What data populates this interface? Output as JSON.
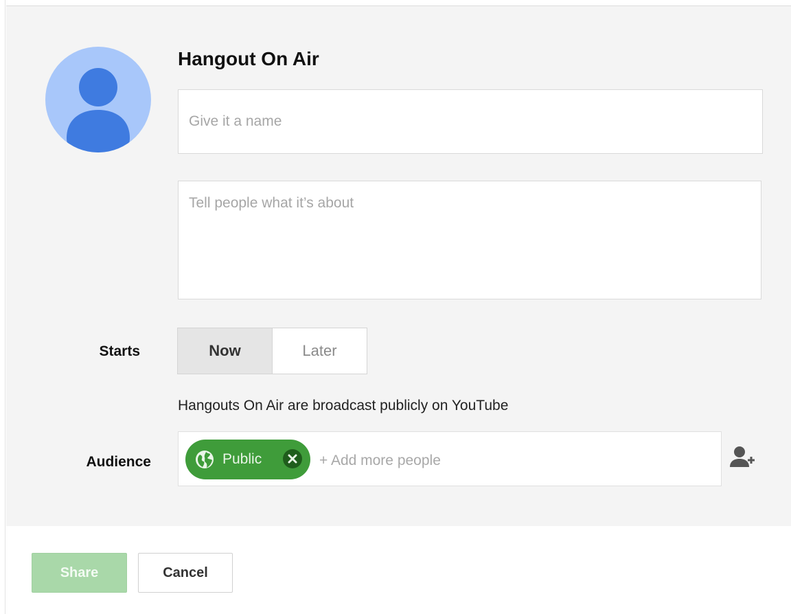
{
  "dialog": {
    "title": "Hangout On Air",
    "name_placeholder": "Give it a name",
    "about_placeholder": "Tell people what it’s about",
    "starts": {
      "label": "Starts",
      "options": [
        "Now",
        "Later"
      ],
      "selected": "Now"
    },
    "notice": "Hangouts On Air are broadcast publicly on YouTube",
    "audience": {
      "label": "Audience",
      "chip": {
        "label": "Public",
        "icon": "globe-icon",
        "color": "#3f9c3a"
      },
      "add_placeholder": "+ Add more people",
      "add_icon": "add-person-icon"
    }
  },
  "footer": {
    "share_label": "Share",
    "cancel_label": "Cancel"
  },
  "colors": {
    "accent_green": "#3f9c3a",
    "share_disabled": "#a9d8a9",
    "avatar_bg": "#a8c7fa",
    "avatar_fg": "#3f7be0"
  }
}
